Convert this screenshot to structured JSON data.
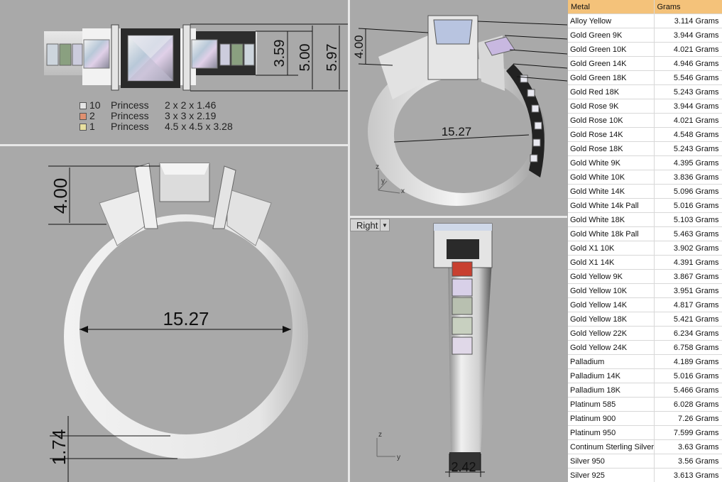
{
  "views": {
    "top": {
      "dims": [
        "3.59",
        "5.00",
        "5.97"
      ],
      "legend": [
        {
          "count": "10",
          "shape": "Princess",
          "size": "2 x 2 x 1.46",
          "color": "#e6e6e6"
        },
        {
          "count": "2",
          "shape": "Princess",
          "size": "3 x 3 x 2.19",
          "color": "#e09070"
        },
        {
          "count": "1",
          "shape": "Princess",
          "size": "4.5 x 4.5 x 3.28",
          "color": "#e8e0a0"
        }
      ]
    },
    "perspective": {
      "dim_height": "4.00",
      "dim_diameter": "15.27",
      "axis_z": "z",
      "axis_y": "y",
      "axis_x": "x"
    },
    "front": {
      "dim_height": "4.00",
      "dim_diameter": "15.27",
      "dim_shank": "1.74"
    },
    "right": {
      "label": "Right",
      "dim_width": "2.42",
      "axis_z": "z",
      "axis_y": "y"
    }
  },
  "table": {
    "headers": {
      "metal": "Metal",
      "grams": "Grams"
    },
    "rows": [
      {
        "metal": "Alloy Yellow",
        "grams": "3.114 Grams"
      },
      {
        "metal": "Gold Green 9K",
        "grams": "3.944 Grams"
      },
      {
        "metal": "Gold Green 10K",
        "grams": "4.021 Grams"
      },
      {
        "metal": "Gold Green 14K",
        "grams": "4.946 Grams"
      },
      {
        "metal": "Gold Green 18K",
        "grams": "5.546 Grams"
      },
      {
        "metal": "Gold Red 18K",
        "grams": "5.243 Grams"
      },
      {
        "metal": "Gold Rose 9K",
        "grams": "3.944 Grams"
      },
      {
        "metal": "Gold Rose 10K",
        "grams": "4.021 Grams"
      },
      {
        "metal": "Gold Rose 14K",
        "grams": "4.548 Grams"
      },
      {
        "metal": "Gold Rose 18K",
        "grams": "5.243 Grams"
      },
      {
        "metal": "Gold White 9K",
        "grams": "4.395 Grams"
      },
      {
        "metal": "Gold White 10K",
        "grams": "3.836 Grams"
      },
      {
        "metal": "Gold White 14K",
        "grams": "5.096 Grams"
      },
      {
        "metal": "Gold White 14k Pall",
        "grams": "5.016 Grams"
      },
      {
        "metal": "Gold White 18K",
        "grams": "5.103 Grams"
      },
      {
        "metal": "Gold White 18k Pall",
        "grams": "5.463 Grams"
      },
      {
        "metal": "Gold X1 10K",
        "grams": "3.902 Grams"
      },
      {
        "metal": "Gold X1 14K",
        "grams": "4.391 Grams"
      },
      {
        "metal": "Gold Yellow 9K",
        "grams": "3.867 Grams"
      },
      {
        "metal": "Gold Yellow 10K",
        "grams": "3.951 Grams"
      },
      {
        "metal": "Gold Yellow 14K",
        "grams": "4.817 Grams"
      },
      {
        "metal": "Gold Yellow 18K",
        "grams": "5.421 Grams"
      },
      {
        "metal": "Gold Yellow 22K",
        "grams": "6.234 Grams"
      },
      {
        "metal": "Gold Yellow 24K",
        "grams": "6.758 Grams"
      },
      {
        "metal": "Palladium",
        "grams": "4.189 Grams"
      },
      {
        "metal": "Palladium 14K",
        "grams": "5.016 Grams"
      },
      {
        "metal": "Palladium 18K",
        "grams": "5.466 Grams"
      },
      {
        "metal": "Platinum 585",
        "grams": "6.028 Grams"
      },
      {
        "metal": "Platinum 900",
        "grams": "7.26 Grams"
      },
      {
        "metal": "Platinum 950",
        "grams": "7.599 Grams"
      },
      {
        "metal": "Continum Sterling Silver",
        "grams": "3.63 Grams"
      },
      {
        "metal": "Silver 950",
        "grams": "3.56 Grams"
      },
      {
        "metal": "Silver 925",
        "grams": "3.613 Grams"
      }
    ]
  }
}
